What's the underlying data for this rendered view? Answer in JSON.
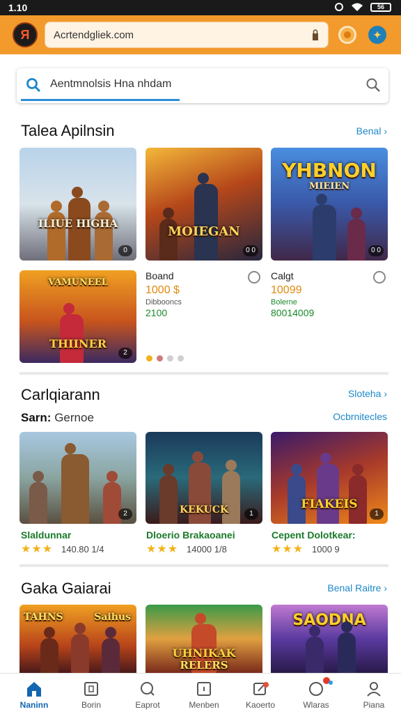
{
  "status": {
    "time": "1.10",
    "battery": "56"
  },
  "app_bar": {
    "url": "Acrtendgliek.com",
    "logo": "Я"
  },
  "search": {
    "query": "Aentmnolsis  Hna  nhdam"
  },
  "section1": {
    "title": "Talea Apilnsin",
    "link": "Benal",
    "cards": [
      {
        "caption": "ILIUE HIGHA",
        "badge": "0"
      },
      {
        "caption": "MOIEGAN",
        "badge": "0 0"
      },
      {
        "caption": "YHBNON",
        "caption2": "MIEIEN",
        "badge": "0 0"
      },
      {
        "caption": "VAMUNEEL",
        "caption2": "THIINER",
        "badge": "2"
      }
    ],
    "items": [
      {
        "name": "Boand",
        "price": "1000 $",
        "sub": "Dibbooncs",
        "code": "2100"
      },
      {
        "name": "Calgt",
        "price": "10099",
        "sub": "Bolerne",
        "code": "80014009"
      }
    ]
  },
  "section2": {
    "title": "Carlqiarann",
    "link": "Sloteha",
    "subtitle_bold": "Sarn:",
    "subtitle_rest": "Gernoe",
    "sublink": "Ocbrnitecles",
    "cards": [
      {
        "caption": "",
        "badge": "2"
      },
      {
        "caption": "KEKUCK",
        "badge": "1"
      },
      {
        "caption": "FIAKEIS",
        "badge": "1"
      }
    ],
    "games": [
      {
        "name": "Slaldunnar",
        "stars": "★★★",
        "rating": "140.80 1/4"
      },
      {
        "name": "Dloerio Brakaoanei",
        "stars": "★★★",
        "rating": "14000 1/8"
      },
      {
        "name": "Cepent  Dolotkear:",
        "stars": "★★★",
        "rating": "1000 9"
      }
    ]
  },
  "section3": {
    "title": "Gaka Gaiarai",
    "link": "Benal Raitre",
    "cards": [
      {
        "caption": "TAHNS",
        "caption2": "Saihus"
      },
      {
        "caption": "UHNIKAK",
        "caption2": "RELERS"
      },
      {
        "caption": "SAODNA"
      }
    ]
  },
  "nav": {
    "items": [
      {
        "label": "Naninn",
        "icon": "home-icon"
      },
      {
        "label": "Borin",
        "icon": "library-icon"
      },
      {
        "label": "Eaprot",
        "icon": "search-icon"
      },
      {
        "label": "Menben",
        "icon": "document-icon"
      },
      {
        "label": "Kaoerto",
        "icon": "edit-icon"
      },
      {
        "label": "Wlaras",
        "icon": "notification-icon"
      },
      {
        "label": "Piana",
        "icon": "profile-icon"
      }
    ]
  },
  "colors": {
    "accent": "#f39a2c",
    "link": "#1e88c8",
    "nav_active": "#1466b0"
  }
}
